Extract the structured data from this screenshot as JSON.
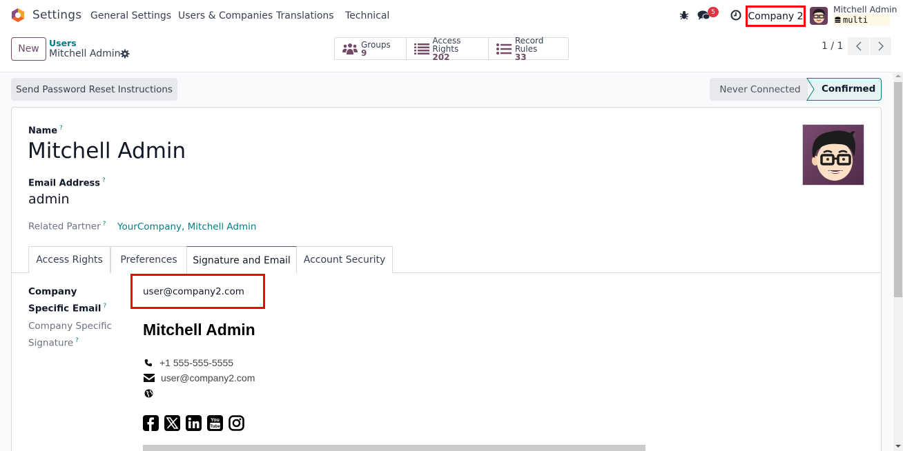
{
  "navbar": {
    "app_name": "Settings",
    "menu": [
      "General Settings",
      "Users & Companies",
      "Translations",
      "Technical"
    ],
    "messages_badge": "5",
    "company": "Company 2",
    "user_name": "Mitchell Admin",
    "database": "multi",
    "icons": [
      "bug-icon",
      "chat-icon",
      "clock-icon"
    ]
  },
  "control_panel": {
    "new_label": "New",
    "breadcrumb_parent": "Users",
    "breadcrumb_current": "Mitchell Admin",
    "smart_buttons": [
      {
        "label": "Groups",
        "value": "9",
        "icon": "users-icon"
      },
      {
        "label": "Access Rights",
        "value": "202",
        "icon": "list-icon"
      },
      {
        "label": "Record Rules",
        "value": "33",
        "icon": "list-ul-icon"
      }
    ],
    "pager": "1 / 1"
  },
  "actions": {
    "reset_password": "Send Password Reset Instructions"
  },
  "statusbar": {
    "stages": [
      "Never Connected",
      "Confirmed"
    ],
    "active": "Confirmed"
  },
  "form": {
    "name_label": "Name",
    "name_value": "Mitchell Admin",
    "email_label": "Email Address",
    "email_value": "admin",
    "partner_label": "Related Partner",
    "partner_value": "YourCompany, Mitchell Admin",
    "help_mark": "?"
  },
  "tabs": [
    {
      "label": "Access Rights",
      "active": false
    },
    {
      "label": "Preferences",
      "active": false
    },
    {
      "label": "Signature and Email",
      "active": true
    },
    {
      "label": "Account Security",
      "active": false
    }
  ],
  "signature_tab": {
    "cse_label": "Company Specific Email",
    "cse_value": "user@company2.com",
    "css_label": "Company Specific Signature",
    "signature": {
      "name": "Mitchell Admin",
      "phone": "+1 555-555-5555",
      "email": "user@company2.com",
      "website": "",
      "social": [
        "facebook-icon",
        "x-twitter-icon",
        "linkedin-icon",
        "youtube-icon",
        "instagram-icon"
      ]
    }
  },
  "colors": {
    "brand": "#714b67",
    "link": "#017e84",
    "highlight": "#ff0000",
    "badge": "#dc3545"
  }
}
